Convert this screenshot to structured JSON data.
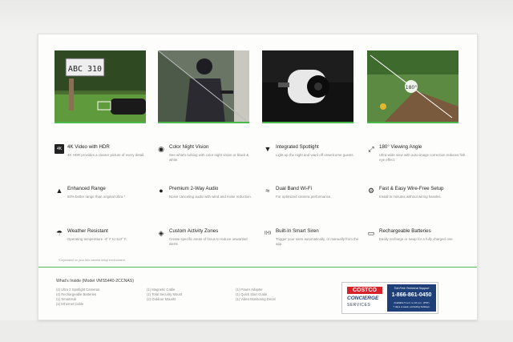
{
  "photos": [
    {
      "name": "photo-4k-license-plate",
      "plate": "ABC 310"
    },
    {
      "name": "photo-night-intruder"
    },
    {
      "name": "photo-spotlight-camera"
    },
    {
      "name": "photo-wide-angle-yard",
      "angle": "180°"
    }
  ],
  "features": [
    {
      "icon": "4k-icon",
      "glyph": "4K",
      "title": "4K Video with HDR",
      "desc": "4K HDR provides a clearer picture of every detail."
    },
    {
      "icon": "eye-icon",
      "glyph": "◉",
      "title": "Color Night Vision",
      "desc": "See what's lurking with color night vision or black & white."
    },
    {
      "icon": "spotlight-icon",
      "glyph": "▼",
      "title": "Integrated Spotlight",
      "desc": "Light up the night and ward off unwelcome guests."
    },
    {
      "icon": "wide-angle-icon",
      "glyph": "⤢",
      "title": "180° Viewing Angle",
      "desc": "Ultra-wide view with auto-image correction reduces fish eye effect."
    },
    {
      "icon": "zoom-icon",
      "glyph": "▲",
      "title": "Enhanced Range",
      "desc": "50% better range than original Ultra.*"
    },
    {
      "icon": "microphone-icon",
      "glyph": "●",
      "title": "Premium 2-Way Audio",
      "desc": "Noise canceling audio with wind and noise reduction."
    },
    {
      "icon": "wifi-icon",
      "glyph": "≈",
      "title": "Dual Band Wi-Fi",
      "desc": "For optimized camera performance."
    },
    {
      "icon": "gear-icon",
      "glyph": "⚙",
      "title": "Fast & Easy Wire-Free Setup",
      "desc": "Install in minutes without wiring hassles."
    },
    {
      "icon": "umbrella-icon",
      "glyph": "☂",
      "title": "Weather Resistant",
      "desc": "Operating temperature -4° F to 113° F."
    },
    {
      "icon": "activity-zone-icon",
      "glyph": "◈",
      "title": "Custom Activity Zones",
      "desc": "Create specific areas of focus to reduce unwanted alerts."
    },
    {
      "icon": "siren-icon",
      "glyph": "((•))",
      "title": "Built-In Smart Siren",
      "desc": "Trigger your siren automatically, or manually from the app."
    },
    {
      "icon": "battery-icon",
      "glyph": "▭",
      "title": "Rechargeable Batteries",
      "desc": "Easily recharge or swap for a fully charged one."
    }
  ],
  "footnote": "*Dependent on your Arlo camera setup environment.",
  "whats_inside": {
    "title": "What's Inside (Model VMS5440-2CCNAS)",
    "columns": [
      [
        "(4) Ultra 2 Spotlight Cameras",
        "(4) Rechargeable Batteries",
        "(1) SmartHub",
        "(1) Ethernet Cable"
      ],
      [
        "(1) Magnetic Cable",
        "(1) Total Security Mount",
        "(2) Outdoor Mounts"
      ],
      [
        "(1) Power Adapter",
        "(1) Quick Start Guide",
        "(1) Video Monitoring Decal"
      ]
    ]
  },
  "costco": {
    "brand": "COSTCO",
    "concierge": "CONCIERGE",
    "services": "SERVICES",
    "support_title": "Toll-Free Technical Support",
    "phone": "1-866-861-0450",
    "hours": "Available 5 a.m. to 10 p.m. (PST)",
    "days": "7 days a week, excluding holidays."
  },
  "colors": {
    "accent": "#4ab84a",
    "costco_blue": "#1f3f78",
    "costco_red": "#d6222a"
  }
}
